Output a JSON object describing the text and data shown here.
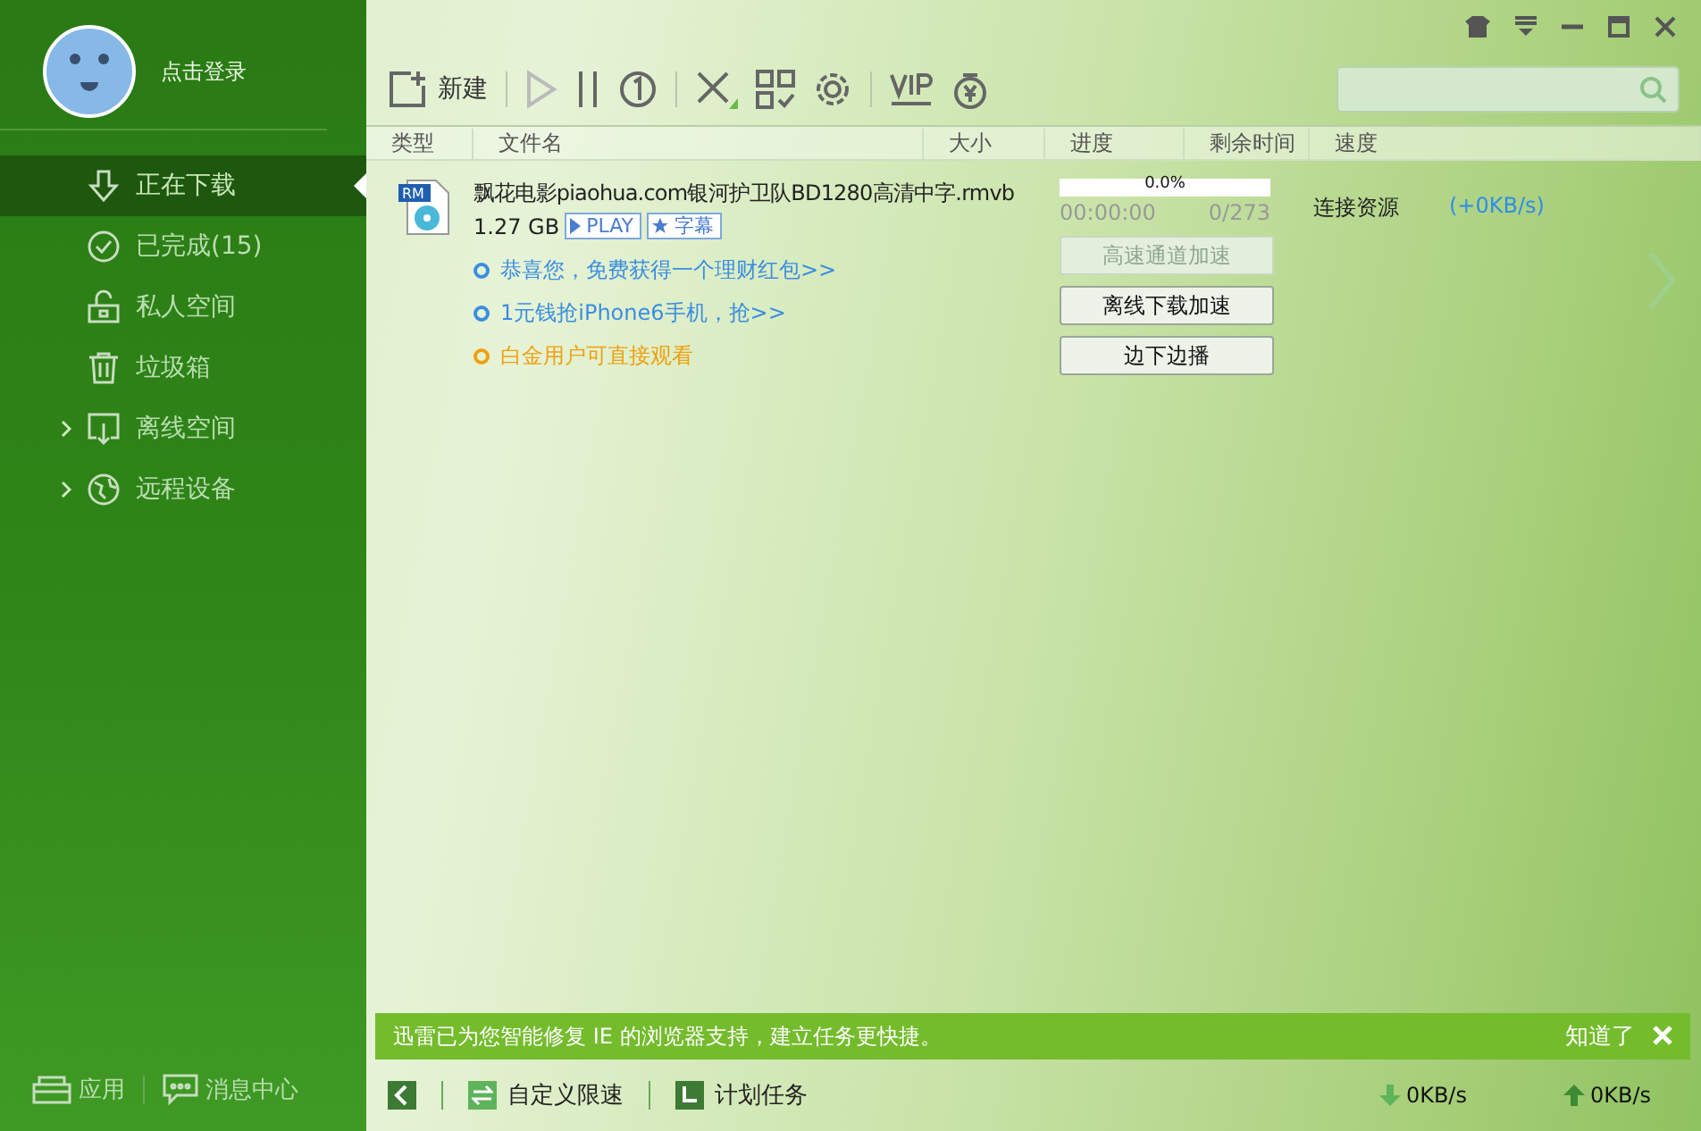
{
  "user": {
    "login": "点击登录"
  },
  "sidebar": {
    "items": [
      {
        "label": "正在下载",
        "selected": true,
        "expandable": false
      },
      {
        "label": "已完成(15)",
        "selected": false,
        "expandable": false
      },
      {
        "label": "私人空间",
        "selected": false,
        "expandable": false
      },
      {
        "label": "垃圾箱",
        "selected": false,
        "expandable": false
      },
      {
        "label": "离线空间",
        "selected": false,
        "expandable": true
      },
      {
        "label": "远程设备",
        "selected": false,
        "expandable": true
      }
    ],
    "footer": [
      "应用",
      "消息中心"
    ]
  },
  "toolbar": {
    "new_label": "新建"
  },
  "table": {
    "columns": [
      "类型",
      "文件名",
      "大小",
      "进度",
      "剩余时间",
      "速度"
    ],
    "task": {
      "type_badge": "RM",
      "name": "飘花电影piaohua.com银河护卫队BD1280高清中字.rmvb",
      "size": "1.27 GB",
      "play": "PLAY",
      "subtitle": "字幕",
      "progress_text": "0.0%",
      "level": 0,
      "elapsed": "00:00:00",
      "pieces": "0/273",
      "status": "连接资源",
      "speed": "(+0KB/s)",
      "links": [
        {
          "text": "恭喜您，免费获得一个理财红包>>",
          "color": "#3b8ee0"
        },
        {
          "text": "1元钱抢iPhone6手机，抢>>",
          "color": "#3b8ee0"
        },
        {
          "text": "白金用户可直接观看",
          "color": "#f0a010"
        }
      ],
      "buttons": [
        {
          "label": "高速通道加速",
          "disabled": true
        },
        {
          "label": "离线下载加速",
          "disabled": false
        },
        {
          "label": "边下边播",
          "disabled": false
        }
      ]
    }
  },
  "notice": {
    "text": "迅雷已为您智能修复 IE 的浏览器支持，建立任务更快捷。",
    "dismiss": "知道了"
  },
  "status_bar": {
    "speed_limit": "自定义限速",
    "schedule": "计划任务",
    "down": "0KB/s",
    "up": "0KB/s"
  }
}
